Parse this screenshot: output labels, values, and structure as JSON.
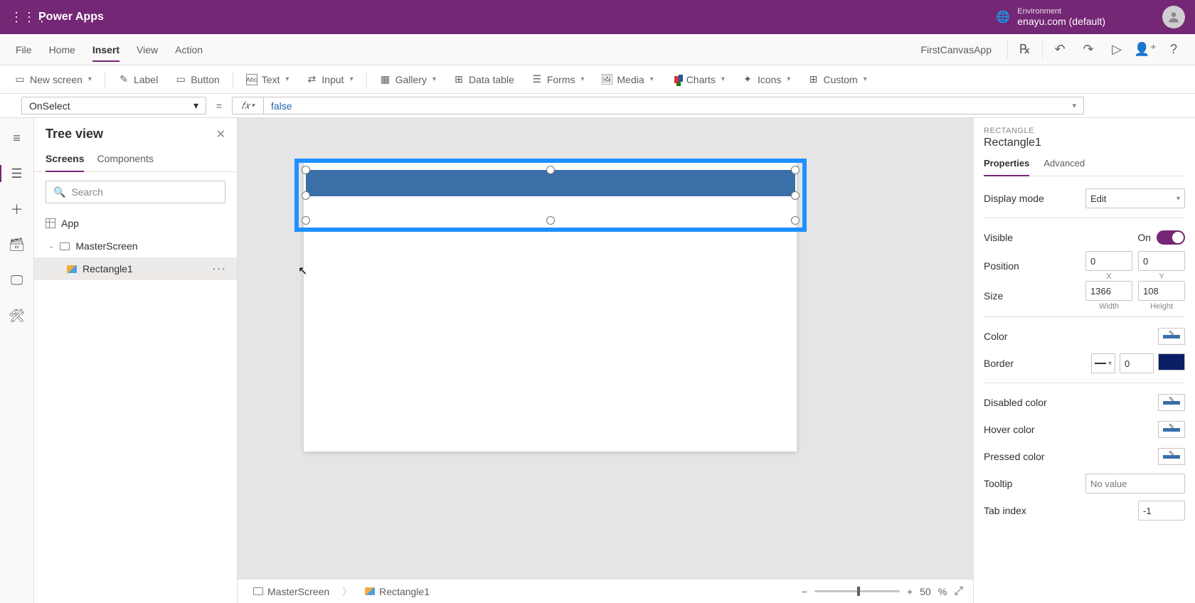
{
  "header": {
    "brand": "Power Apps",
    "env_label": "Environment",
    "env_value": "enayu.com (default)"
  },
  "menubar": {
    "items": [
      "File",
      "Home",
      "Insert",
      "View",
      "Action"
    ],
    "active": "Insert",
    "app_name": "FirstCanvasApp"
  },
  "ribbon": {
    "new_screen": "New screen",
    "label": "Label",
    "button": "Button",
    "text": "Text",
    "input": "Input",
    "gallery": "Gallery",
    "data_table": "Data table",
    "forms": "Forms",
    "media": "Media",
    "charts": "Charts",
    "icons": "Icons",
    "custom": "Custom"
  },
  "formula": {
    "property": "OnSelect",
    "value": "false"
  },
  "tree": {
    "title": "Tree view",
    "tabs": {
      "screens": "Screens",
      "components": "Components"
    },
    "search_placeholder": "Search",
    "app": "App",
    "screen": "MasterScreen",
    "rect": "Rectangle1"
  },
  "breadcrumb": {
    "screen": "MasterScreen",
    "item": "Rectangle1",
    "zoom": "50",
    "zoom_unit": "%"
  },
  "props": {
    "kind": "RECTANGLE",
    "name": "Rectangle1",
    "tabs": {
      "properties": "Properties",
      "advanced": "Advanced"
    },
    "display_mode_label": "Display mode",
    "display_mode_value": "Edit",
    "visible_label": "Visible",
    "visible_state": "On",
    "position_label": "Position",
    "position_x": "0",
    "position_y": "0",
    "x_label": "X",
    "y_label": "Y",
    "size_label": "Size",
    "size_w": "1366",
    "size_h": "108",
    "w_label": "Width",
    "h_label": "Height",
    "color_label": "Color",
    "color_value": "#3b6fa8",
    "border_label": "Border",
    "border_width": "0",
    "border_color": "#0b1f66",
    "disabled_label": "Disabled color",
    "hover_label": "Hover color",
    "pressed_label": "Pressed color",
    "tooltip_label": "Tooltip",
    "tooltip_placeholder": "No value",
    "tabindex_label": "Tab index",
    "tabindex_value": "-1"
  }
}
